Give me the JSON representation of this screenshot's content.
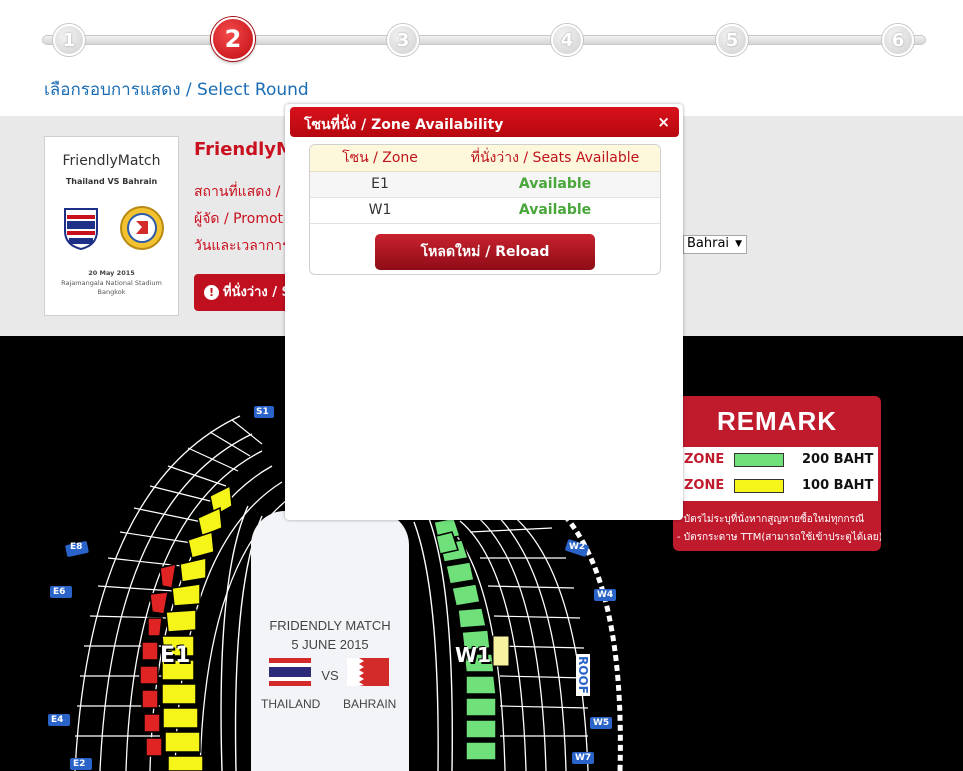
{
  "steps": [
    "1",
    "2",
    "3",
    "4",
    "5",
    "6"
  ],
  "active_step": "2",
  "step_title": "เลือกรอบการแสดง / Select Round",
  "poster": {
    "title": "FriendlyMatch",
    "subtitle": "Thailand VS Bahrain",
    "date": "20 May 2015",
    "venue_line1": "Rajamangala National Stadium",
    "venue_line2": "Bangkok"
  },
  "event": {
    "title": "FriendlyMa",
    "venue_label": "สถานที่แสดง /",
    "promoter_label": "ผู้จัด / Promot",
    "datetime_label": "วันและเวลาการแ",
    "round_selected": "Bahrai",
    "seats_button": "ที่นั่งว่าง / S"
  },
  "remark": {
    "title": "REMARK",
    "legend": [
      {
        "zone": "ZONE",
        "price": "200 BAHT",
        "color": "#6fe07a"
      },
      {
        "zone": "ZONE",
        "price": "100 BAHT",
        "color": "#f6f51a"
      }
    ],
    "note1": "- บัตรไม่ระบุที่นั่งหากสูญหายซื้อใหม่ทุกกรณี",
    "note2": "- บัตรกระดาษ TTM(สามารถใช้เข้าประตูได้เลย)"
  },
  "match_card": {
    "title": "FRIDENDLY MATCH",
    "date": "5 JUNE 2015",
    "vs": "VS",
    "team_left": "THAILAND",
    "team_right": "BAHRAIN"
  },
  "stadium_labels": {
    "zone_e1": "E1",
    "zone_w1": "W1",
    "roof": "ROOF",
    "markers": [
      "S1",
      "E8",
      "E6",
      "E4",
      "E2",
      "W2",
      "W4",
      "W5",
      "W7"
    ]
  },
  "modal": {
    "title": "โซนที่นั่ง / Zone Availability",
    "close": "×",
    "col_zone": "โซน / Zone",
    "col_seats": "ที่นั่งว่าง / Seats Available",
    "rows": [
      {
        "zone": "E1",
        "status": "Available"
      },
      {
        "zone": "W1",
        "status": "Available"
      }
    ],
    "reload": "โหลดใหม่ / Reload"
  },
  "colors": {
    "brand_red": "#c8101e",
    "link_blue": "#1a6db5",
    "available_green": "#49a63a",
    "zone_green": "#6fe07a",
    "zone_yellow": "#f6f51a"
  }
}
